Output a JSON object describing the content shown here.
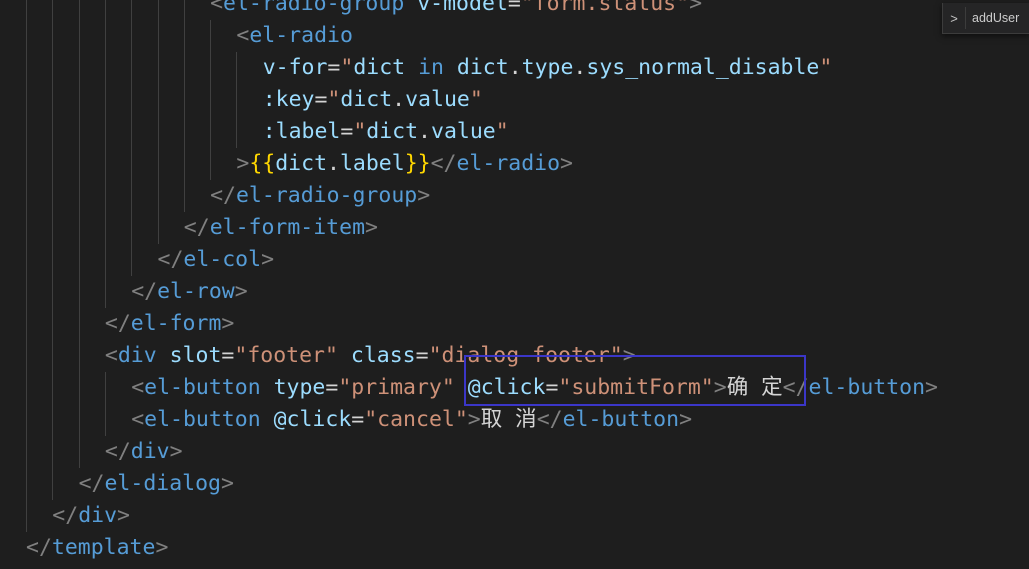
{
  "breadcrumb": {
    "chevron": ">",
    "label": "addUser"
  },
  "code": {
    "lines": [
      {
        "indent": 8,
        "tokens": [
          [
            "punct",
            "<"
          ],
          [
            "tag",
            "el-radio-group"
          ],
          [
            "text",
            " "
          ],
          [
            "attr",
            "v-model"
          ],
          [
            "text",
            "="
          ],
          [
            "str",
            "\"form.status\""
          ],
          [
            "punct",
            ">"
          ]
        ]
      },
      {
        "indent": 9,
        "tokens": [
          [
            "punct",
            "<"
          ],
          [
            "tag",
            "el-radio"
          ]
        ]
      },
      {
        "indent": 10,
        "tokens": [
          [
            "attr",
            "v-for"
          ],
          [
            "text",
            "="
          ],
          [
            "str",
            "\""
          ],
          [
            "var",
            "dict"
          ],
          [
            "text",
            " "
          ],
          [
            "kw",
            "in"
          ],
          [
            "text",
            " "
          ],
          [
            "var",
            "dict"
          ],
          [
            "text",
            "."
          ],
          [
            "var",
            "type"
          ],
          [
            "text",
            "."
          ],
          [
            "var",
            "sys_normal_disable"
          ],
          [
            "str",
            "\""
          ]
        ]
      },
      {
        "indent": 10,
        "tokens": [
          [
            "attr",
            ":key"
          ],
          [
            "text",
            "="
          ],
          [
            "str",
            "\""
          ],
          [
            "var",
            "dict"
          ],
          [
            "text",
            "."
          ],
          [
            "var",
            "value"
          ],
          [
            "str",
            "\""
          ]
        ]
      },
      {
        "indent": 10,
        "tokens": [
          [
            "attr",
            ":label"
          ],
          [
            "text",
            "="
          ],
          [
            "str",
            "\""
          ],
          [
            "var",
            "dict"
          ],
          [
            "text",
            "."
          ],
          [
            "var",
            "value"
          ],
          [
            "str",
            "\""
          ]
        ]
      },
      {
        "indent": 9,
        "tokens": [
          [
            "punct",
            ">"
          ],
          [
            "brace",
            "{{"
          ],
          [
            "var",
            "dict"
          ],
          [
            "text",
            "."
          ],
          [
            "var",
            "label"
          ],
          [
            "brace",
            "}}"
          ],
          [
            "punct",
            "</"
          ],
          [
            "tag",
            "el-radio"
          ],
          [
            "punct",
            ">"
          ]
        ]
      },
      {
        "indent": 8,
        "tokens": [
          [
            "punct",
            "</"
          ],
          [
            "tag",
            "el-radio-group"
          ],
          [
            "punct",
            ">"
          ]
        ]
      },
      {
        "indent": 7,
        "tokens": [
          [
            "punct",
            "</"
          ],
          [
            "tag",
            "el-form-item"
          ],
          [
            "punct",
            ">"
          ]
        ]
      },
      {
        "indent": 6,
        "tokens": [
          [
            "punct",
            "</"
          ],
          [
            "tag",
            "el-col"
          ],
          [
            "punct",
            ">"
          ]
        ]
      },
      {
        "indent": 5,
        "tokens": [
          [
            "punct",
            "</"
          ],
          [
            "tag",
            "el-row"
          ],
          [
            "punct",
            ">"
          ]
        ]
      },
      {
        "indent": 4,
        "tokens": [
          [
            "punct",
            "</"
          ],
          [
            "tag",
            "el-form"
          ],
          [
            "punct",
            ">"
          ]
        ]
      },
      {
        "indent": 4,
        "tokens": [
          [
            "punct",
            "<"
          ],
          [
            "tag",
            "div"
          ],
          [
            "text",
            " "
          ],
          [
            "attr",
            "slot"
          ],
          [
            "text",
            "="
          ],
          [
            "str",
            "\"footer\""
          ],
          [
            "text",
            " "
          ],
          [
            "attr",
            "class"
          ],
          [
            "text",
            "="
          ],
          [
            "str",
            "\"dialog-footer\""
          ],
          [
            "punct",
            ">"
          ]
        ]
      },
      {
        "indent": 5,
        "tokens": [
          [
            "punct",
            "<"
          ],
          [
            "tag",
            "el-button"
          ],
          [
            "text",
            " "
          ],
          [
            "attr",
            "type"
          ],
          [
            "text",
            "="
          ],
          [
            "str",
            "\"primary\""
          ],
          [
            "text",
            " "
          ],
          [
            "attr",
            "@click"
          ],
          [
            "text",
            "="
          ],
          [
            "str",
            "\"submitForm\""
          ],
          [
            "punct",
            ">"
          ],
          [
            "text",
            "确 定"
          ],
          [
            "punct",
            "</"
          ],
          [
            "tag",
            "el-button"
          ],
          [
            "punct",
            ">"
          ]
        ]
      },
      {
        "indent": 5,
        "tokens": [
          [
            "punct",
            "<"
          ],
          [
            "tag",
            "el-button"
          ],
          [
            "text",
            " "
          ],
          [
            "attr",
            "@click"
          ],
          [
            "text",
            "="
          ],
          [
            "str",
            "\"cancel\""
          ],
          [
            "punct",
            ">"
          ],
          [
            "text",
            "取 消"
          ],
          [
            "punct",
            "</"
          ],
          [
            "tag",
            "el-button"
          ],
          [
            "punct",
            ">"
          ]
        ]
      },
      {
        "indent": 4,
        "tokens": [
          [
            "punct",
            "</"
          ],
          [
            "tag",
            "div"
          ],
          [
            "punct",
            ">"
          ]
        ]
      },
      {
        "indent": 3,
        "tokens": [
          [
            "punct",
            "</"
          ],
          [
            "tag",
            "el-dialog"
          ],
          [
            "punct",
            ">"
          ]
        ]
      },
      {
        "indent": 2,
        "tokens": [
          [
            "punct",
            "</"
          ],
          [
            "tag",
            "div"
          ],
          [
            "punct",
            ">"
          ]
        ]
      },
      {
        "indent": 1,
        "tokens": [
          [
            "punct",
            "</"
          ],
          [
            "tag",
            "template"
          ],
          [
            "punct",
            ">"
          ]
        ]
      }
    ]
  },
  "colors": {
    "background": "#1e1e1e",
    "tag": "#569cd6",
    "attribute": "#9cdcfe",
    "string": "#ce9178",
    "punctuation": "#808080",
    "braces": "#ffd700",
    "highlight_box": "#3b36c8"
  }
}
